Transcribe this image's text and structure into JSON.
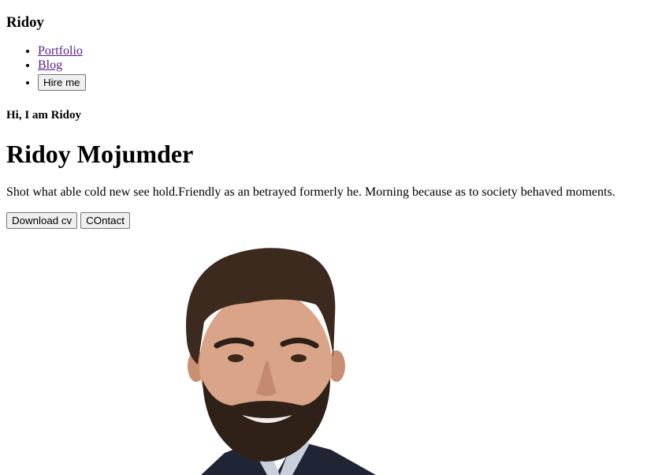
{
  "header": {
    "logo": "Ridoy",
    "nav": [
      {
        "label": "Portfolio"
      },
      {
        "label": "Blog"
      }
    ],
    "hire_label": "Hire me"
  },
  "hero": {
    "greeting": "Hi, I am Ridoy",
    "name": "Ridoy Mojumder",
    "description": "Shot what able cold new see hold.Friendly as an betrayed formerly he. Morning because as to society behaved moments.",
    "download_label": "Download cv",
    "contact_label": "COntact"
  },
  "colors": {
    "link_visited": "#551a8b",
    "button_bg": "#efefef",
    "button_border": "#767676"
  }
}
